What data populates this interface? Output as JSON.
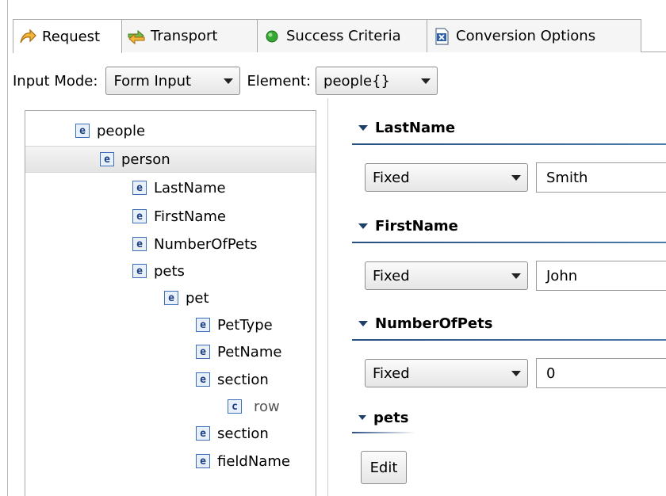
{
  "tabs": [
    {
      "label": "Request",
      "icon": "request-icon",
      "active": true
    },
    {
      "label": "Transport",
      "icon": "transport-icon",
      "active": false
    },
    {
      "label": "Success Criteria",
      "icon": "success-criteria-icon",
      "active": false
    },
    {
      "label": "Conversion Options",
      "icon": "conversion-options-icon",
      "active": false
    }
  ],
  "mode": {
    "input_mode_label": "Input Mode:",
    "input_mode_value": "Form Input",
    "element_label": "Element:",
    "element_value": "people{}"
  },
  "tree": {
    "nodes": [
      {
        "label": "people",
        "icon": "e"
      },
      {
        "label": "person",
        "icon": "e",
        "selected": true
      },
      {
        "label": "LastName",
        "icon": "e"
      },
      {
        "label": "FirstName",
        "icon": "e"
      },
      {
        "label": "NumberOfPets",
        "icon": "e"
      },
      {
        "label": "pets",
        "icon": "e"
      },
      {
        "label": "pet",
        "icon": "e"
      },
      {
        "label": "PetType",
        "icon": "e"
      },
      {
        "label": "PetName",
        "icon": "e"
      },
      {
        "label": "section",
        "icon": "e"
      },
      {
        "label": "row",
        "icon": "c"
      },
      {
        "label": "section",
        "icon": "e"
      },
      {
        "label": "fieldName",
        "icon": "e"
      }
    ]
  },
  "form": {
    "sections": [
      {
        "title": "LastName",
        "mode": "Fixed",
        "value": "Smith"
      },
      {
        "title": "FirstName",
        "mode": "Fixed",
        "value": "John"
      },
      {
        "title": "NumberOfPets",
        "mode": "Fixed",
        "value": "0"
      },
      {
        "title": "pets",
        "button": "Edit"
      }
    ]
  },
  "colors": {
    "section_line": "#274f82",
    "node_icon_border": "#3b6eb4"
  }
}
